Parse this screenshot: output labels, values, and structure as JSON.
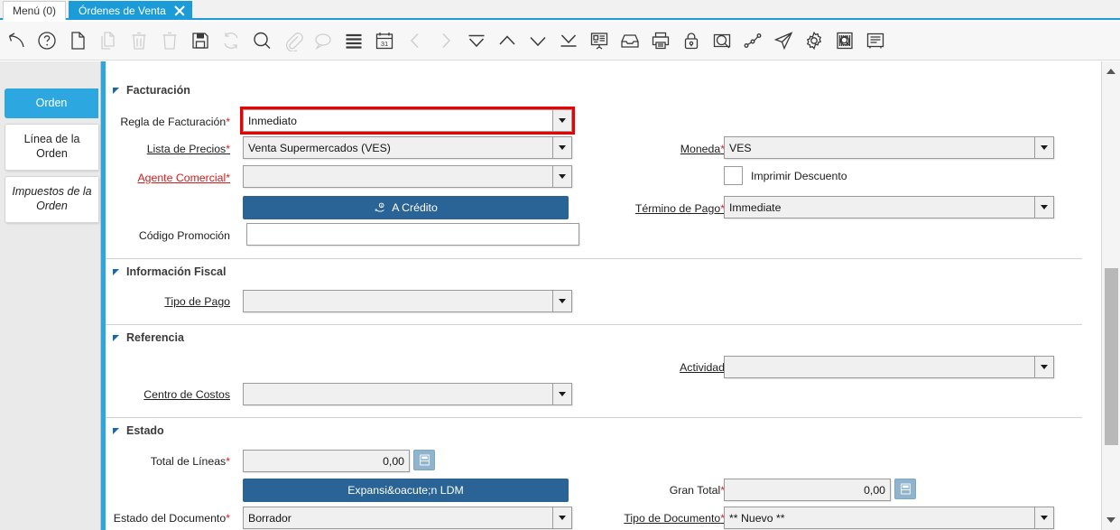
{
  "window_tabs": [
    {
      "label": "Menú (0)",
      "active": false,
      "closable": false
    },
    {
      "label": "Órdenes de Venta",
      "active": true,
      "closable": true
    }
  ],
  "toolbar": {
    "icons": [
      {
        "name": "undo-icon",
        "enabled": true
      },
      {
        "name": "help-icon",
        "enabled": true
      },
      {
        "name": "new-record-icon",
        "enabled": true
      },
      {
        "name": "copy-record-icon",
        "enabled": false
      },
      {
        "name": "delete-record-icon",
        "enabled": false
      },
      {
        "name": "delete-selection-icon",
        "enabled": false
      },
      {
        "name": "save-icon",
        "enabled": true
      },
      {
        "name": "refresh-icon",
        "enabled": false
      },
      {
        "name": "find-icon",
        "enabled": true
      },
      {
        "name": "attachment-icon",
        "enabled": false
      },
      {
        "name": "chat-icon",
        "enabled": false
      },
      {
        "name": "grid-toggle-icon",
        "enabled": true
      },
      {
        "name": "calendar-icon",
        "enabled": true
      },
      {
        "name": "previous-record-icon",
        "enabled": false
      },
      {
        "name": "next-record-icon",
        "enabled": false
      },
      {
        "name": "first-record-icon",
        "enabled": true
      },
      {
        "name": "up-record-icon",
        "enabled": true
      },
      {
        "name": "down-record-icon",
        "enabled": true
      },
      {
        "name": "last-record-icon",
        "enabled": true
      },
      {
        "name": "report-icon",
        "enabled": true
      },
      {
        "name": "archive-icon",
        "enabled": true
      },
      {
        "name": "print-icon",
        "enabled": true
      },
      {
        "name": "lock-icon",
        "enabled": true
      },
      {
        "name": "zoom-across-icon",
        "enabled": true
      },
      {
        "name": "workflow-icon",
        "enabled": true
      },
      {
        "name": "send-icon",
        "enabled": true
      },
      {
        "name": "preferences-icon",
        "enabled": true
      },
      {
        "name": "product-info-icon",
        "enabled": true
      },
      {
        "name": "request-icon",
        "enabled": true
      }
    ]
  },
  "side_tabs": [
    {
      "label": "Orden",
      "selected": true
    },
    {
      "label": "Línea de la Orden",
      "selected": false
    },
    {
      "label": "Impuestos de la Orden",
      "selected": false
    }
  ],
  "sections": {
    "facturacion": {
      "title": "Facturación"
    },
    "informacion_fiscal": {
      "title": "Información Fiscal"
    },
    "referencia": {
      "title": "Referencia"
    },
    "estado": {
      "title": "Estado"
    }
  },
  "fields": {
    "regla_facturacion": {
      "label": "Regla de Facturación",
      "required": true,
      "value": "Inmediato",
      "highlighted": true
    },
    "lista_precios": {
      "label": "Lista de Precios",
      "required": true,
      "value": "Venta Supermercados (VES)"
    },
    "agente_comercial": {
      "label": "Agente Comercial",
      "required": true,
      "value": ""
    },
    "codigo_promocion": {
      "label": "Código Promoción",
      "required": false,
      "value": ""
    },
    "moneda": {
      "label": "Moneda",
      "required": true,
      "value": "VES"
    },
    "imprimir_descuento": {
      "label": "Imprimir Descuento",
      "checked": false
    },
    "termino_pago": {
      "label": "Término de Pago",
      "required": true,
      "value": "Immediate"
    },
    "tipo_pago": {
      "label": "Tipo de Pago",
      "required": false,
      "value": ""
    },
    "actividad": {
      "label": "Actividad",
      "required": false,
      "value": ""
    },
    "centro_costos": {
      "label": "Centro de Costos",
      "required": false,
      "value": ""
    },
    "total_lineas": {
      "label": "Total de Líneas",
      "required": true,
      "value": "0,00"
    },
    "gran_total": {
      "label": "Gran Total",
      "required": true,
      "value": "0,00"
    },
    "estado_documento": {
      "label": "Estado del Documento",
      "required": true,
      "value": "Borrador"
    },
    "tipo_documento": {
      "label": "Tipo de Documento",
      "required": true,
      "value": "** Nuevo **"
    }
  },
  "buttons": {
    "a_credito": {
      "label": "A Crédito",
      "icon": "hand-coin-icon"
    },
    "expansion_ldm": {
      "label": "Expansi&oacute;n LDM"
    }
  },
  "colors": {
    "accent_blue": "#2ca7e0",
    "button_blue": "#2a6496",
    "required_red": "#e02020",
    "highlight_red": "#ee0000",
    "calc_button_blue": "#90b4cd"
  },
  "scrollbar": {
    "orientation": "vertical",
    "up_arrow": "scroll-up-arrow",
    "down_arrow": "scroll-down-arrow"
  }
}
